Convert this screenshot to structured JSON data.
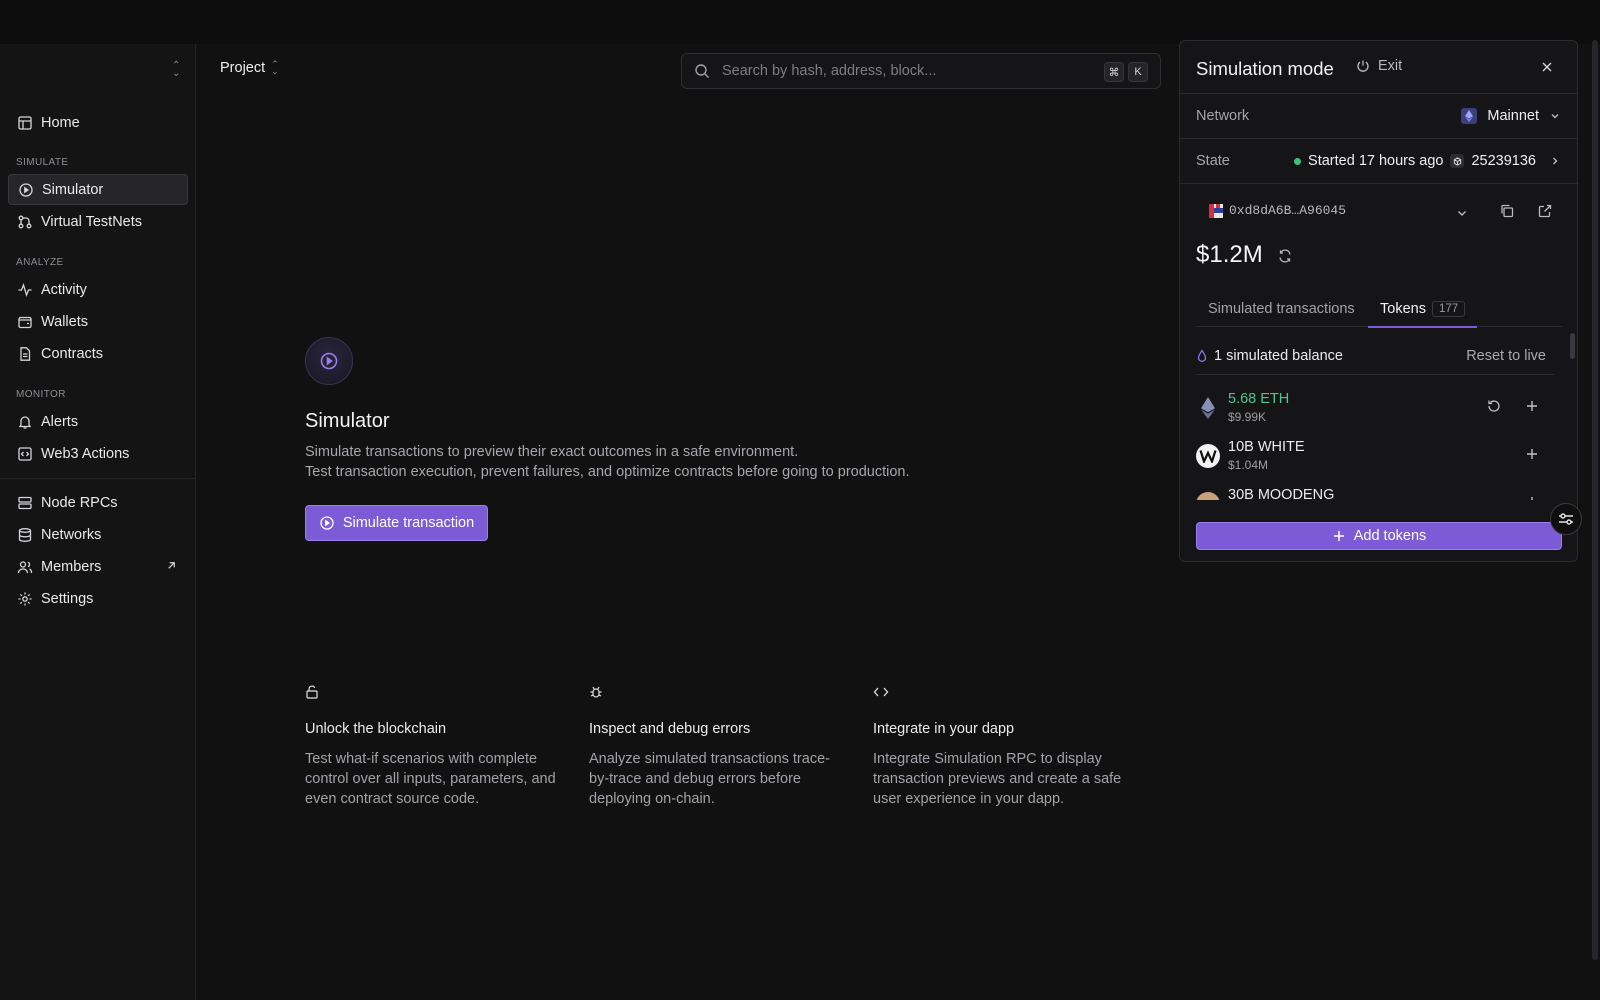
{
  "sidebar": {
    "items": [
      {
        "label": "Home"
      },
      {
        "label": "Simulator"
      },
      {
        "label": "Virtual TestNets"
      },
      {
        "label": "Activity"
      },
      {
        "label": "Wallets"
      },
      {
        "label": "Contracts"
      },
      {
        "label": "Alerts"
      },
      {
        "label": "Web3 Actions"
      },
      {
        "label": "Node RPCs"
      },
      {
        "label": "Networks"
      },
      {
        "label": "Members"
      },
      {
        "label": "Settings"
      }
    ],
    "sections": {
      "simulate": "SIMULATE",
      "analyze": "ANALYZE",
      "monitor": "MONITOR"
    }
  },
  "header": {
    "project": "Project",
    "search_placeholder": "Search by hash, address, block...",
    "kbd_cmd": "⌘",
    "kbd_k": "K"
  },
  "hero": {
    "title": "Simulator",
    "desc_line1": "Simulate transactions to preview their exact outcomes in a safe environment.",
    "desc_line2": "Test transaction execution, prevent failures, and optimize contracts before going to production.",
    "button": "Simulate transaction"
  },
  "features": [
    {
      "title": "Unlock the blockchain",
      "desc": "Test what-if scenarios with complete control over all inputs, parameters, and even contract source code."
    },
    {
      "title": "Inspect and debug errors",
      "desc": "Analyze simulated transactions trace-by-trace and debug errors before deploying on-chain."
    },
    {
      "title": "Integrate in your dapp",
      "desc": "Integrate Simulation RPC to display transaction previews and create a safe user experience in your dapp."
    }
  ],
  "panel": {
    "title": "Simulation mode",
    "exit": "Exit",
    "network_label": "Network",
    "network_value": "Mainnet",
    "state_label": "State",
    "state_value": "Started 17 hours ago",
    "block_number": "25239136",
    "address": "0xd8dA6B…A96045",
    "balance": "$1.2M",
    "tabs": {
      "simulated": "Simulated transactions",
      "tokens": "Tokens",
      "tokens_count": "177"
    },
    "sim_balance_text": "1 simulated balance",
    "reset_label": "Reset to live",
    "tokens": [
      {
        "amount": "5.68 ETH",
        "usd": "$9.99K"
      },
      {
        "amount": "10B WHITE",
        "usd": "$1.04M"
      },
      {
        "amount": "30B MOODENG",
        "usd": ""
      }
    ],
    "add_tokens": "Add tokens"
  },
  "colors": {
    "accent": "#7b5bd6",
    "positive": "#52c48d",
    "status": "#3ec27a"
  }
}
